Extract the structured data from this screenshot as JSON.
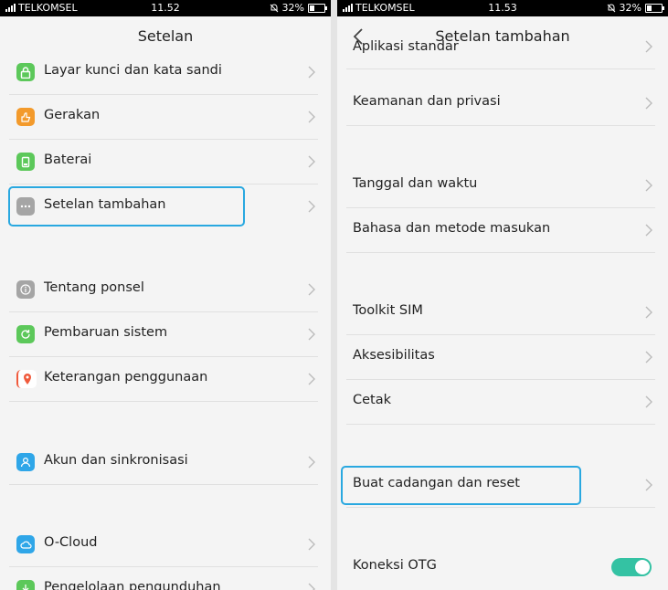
{
  "left": {
    "status": {
      "carrier": "TELKOMSEL",
      "time": "11.52",
      "battery": "32%"
    },
    "title": "Setelan",
    "items": [
      {
        "label": "Layar kunci dan kata sandi",
        "icon": "lock-icon",
        "color": "#5cc85a"
      },
      {
        "label": "Gerakan",
        "icon": "gesture-icon",
        "color": "#f39a2b"
      },
      {
        "label": "Baterai",
        "icon": "battery-icon",
        "color": "#5cc85a"
      },
      {
        "label": "Setelan tambahan",
        "icon": "more-dots-icon",
        "color": "#a5a5a5"
      },
      {
        "label": "Tentang ponsel",
        "icon": "info-icon",
        "color": "#a5a5a5"
      },
      {
        "label": "Pembaruan sistem",
        "icon": "update-icon",
        "color": "#5cc85a"
      },
      {
        "label": "Keterangan penggunaan",
        "icon": "usage-icon",
        "color": "#f05a3c"
      },
      {
        "label": "Akun dan sinkronisasi",
        "icon": "account-icon",
        "color": "#2fa6e8"
      },
      {
        "label": "O-Cloud",
        "icon": "cloud-icon",
        "color": "#2fa6e8"
      },
      {
        "label": "Pengelolaan pengunduhan",
        "icon": "download-icon",
        "color": "#5cc85a"
      }
    ]
  },
  "right": {
    "status": {
      "carrier": "TELKOMSEL",
      "time": "11.53",
      "battery": "32%"
    },
    "title": "Setelan tambahan",
    "items": [
      {
        "label": "Aplikasi standar"
      },
      {
        "label": "Keamanan dan privasi"
      },
      {
        "label": "Tanggal dan waktu"
      },
      {
        "label": "Bahasa dan metode masukan"
      },
      {
        "label": "Toolkit SIM"
      },
      {
        "label": "Aksesibilitas"
      },
      {
        "label": "Cetak"
      },
      {
        "label": "Buat cadangan dan reset"
      },
      {
        "label": "Koneksi OTG",
        "toggle_on": true
      }
    ]
  },
  "colors": {
    "highlight": "#29a8e0",
    "toggle": "#34c2a3"
  }
}
